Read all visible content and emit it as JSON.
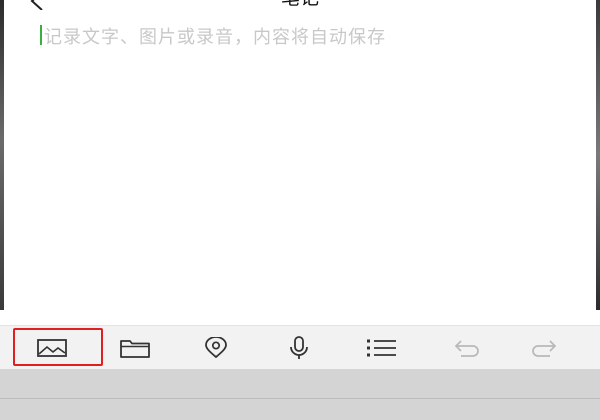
{
  "header": {
    "title": "笔记",
    "back_icon": "chevron-left-icon"
  },
  "editor": {
    "placeholder": "记录文字、图片或录音，内容将自动保存",
    "cursor_color": "#38b040"
  },
  "toolbar": {
    "items": [
      {
        "icon": "image-icon",
        "active": true
      },
      {
        "icon": "folder-icon"
      },
      {
        "icon": "location-icon"
      },
      {
        "icon": "microphone-icon"
      },
      {
        "icon": "list-icon"
      },
      {
        "icon": "undo-icon",
        "enabled": false
      },
      {
        "icon": "redo-icon",
        "enabled": false
      }
    ],
    "highlight_color": "#e02020"
  }
}
